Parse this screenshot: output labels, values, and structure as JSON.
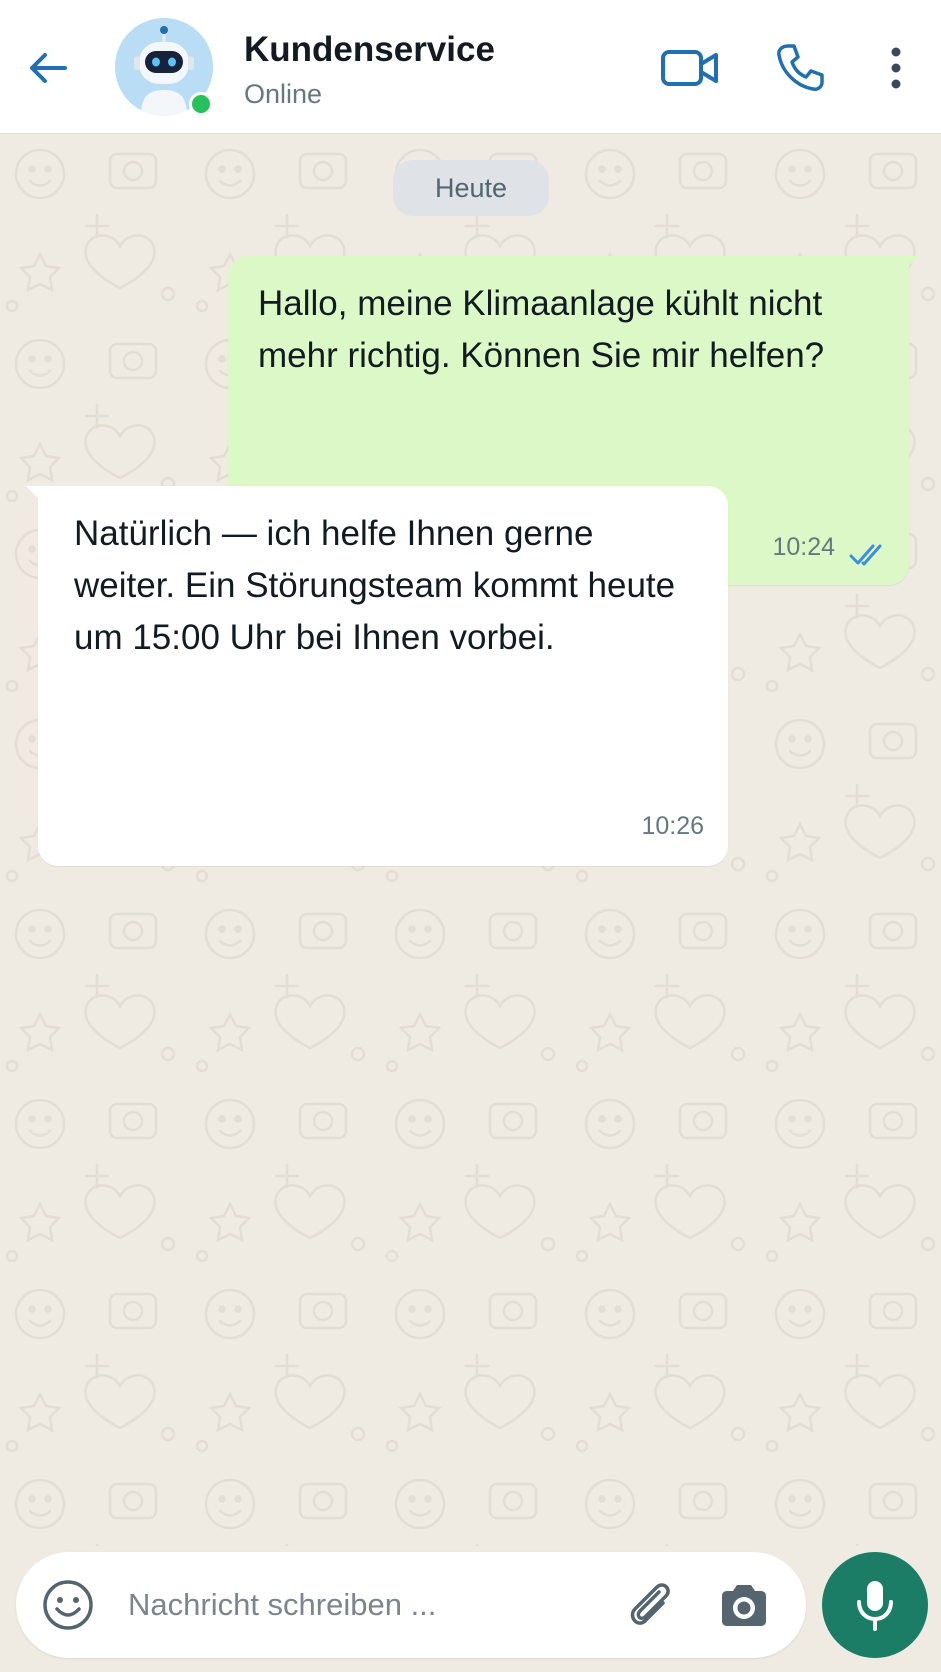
{
  "header": {
    "back_icon": "arrow-left-icon",
    "avatar_icon": "robot-avatar-icon",
    "contact_name": "Kundenservice",
    "contact_status": "Online",
    "video_icon": "video-camera-icon",
    "phone_icon": "phone-icon",
    "menu_icon": "more-vertical-icon"
  },
  "chat": {
    "date_chip": "Heute",
    "messages": [
      {
        "direction": "outgoing",
        "text": "Hallo, meine Klimaanlage kühlt nicht mehr richtig. Können Sie mir helfen?",
        "time": "10:24",
        "status": "read"
      },
      {
        "direction": "incoming",
        "text": "Natürlich — ich helfe Ihnen gerne weiter. Ein Störungsteam kommt heute um 15:00 Uhr bei Ihnen vorbei.",
        "time": "10:26"
      }
    ]
  },
  "composer": {
    "placeholder": "Nachricht schreiben ...",
    "value": "",
    "emoji_icon": "emoji-icon",
    "attach_icon": "paperclip-icon",
    "camera_icon": "camera-icon",
    "mic_icon": "microphone-icon"
  },
  "colors": {
    "accent": "#1f6fb2",
    "outgoing_bubble": "#dcf8c6",
    "incoming_bubble": "#ffffff",
    "chat_background": "#efeae2",
    "mic_button": "#1c7d66",
    "online_dot": "#25c15a",
    "read_ticks": "#3b8ee0"
  }
}
